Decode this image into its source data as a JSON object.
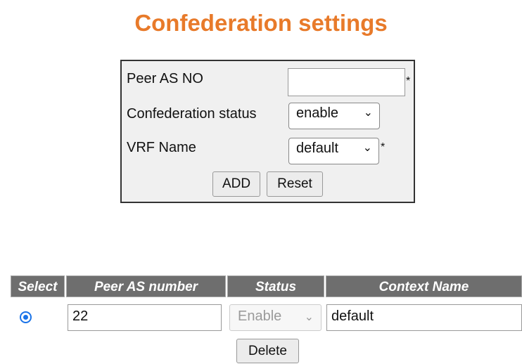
{
  "page": {
    "title": "Confederation settings"
  },
  "form": {
    "peer_as_label": "Peer AS NO",
    "peer_as_value": "",
    "peer_as_required": "*",
    "status_label": "Confederation status",
    "status_value": "enable",
    "vrf_label": "VRF Name",
    "vrf_value": "default",
    "vrf_required": "*",
    "add_label": "ADD",
    "reset_label": "Reset"
  },
  "table": {
    "headers": [
      "Select",
      "Peer AS number",
      "Status",
      "Context Name"
    ],
    "rows": [
      {
        "selected": true,
        "peer_as": "22",
        "status": "Enable",
        "context": "default"
      }
    ],
    "delete_label": "Delete"
  },
  "icons": {
    "dropdown": "chevron-down-icon",
    "radio": "radio-selected-icon"
  },
  "colors": {
    "title": "#e87a2a",
    "header_bg": "#6e6e6e",
    "radio": "#1a73e8"
  }
}
